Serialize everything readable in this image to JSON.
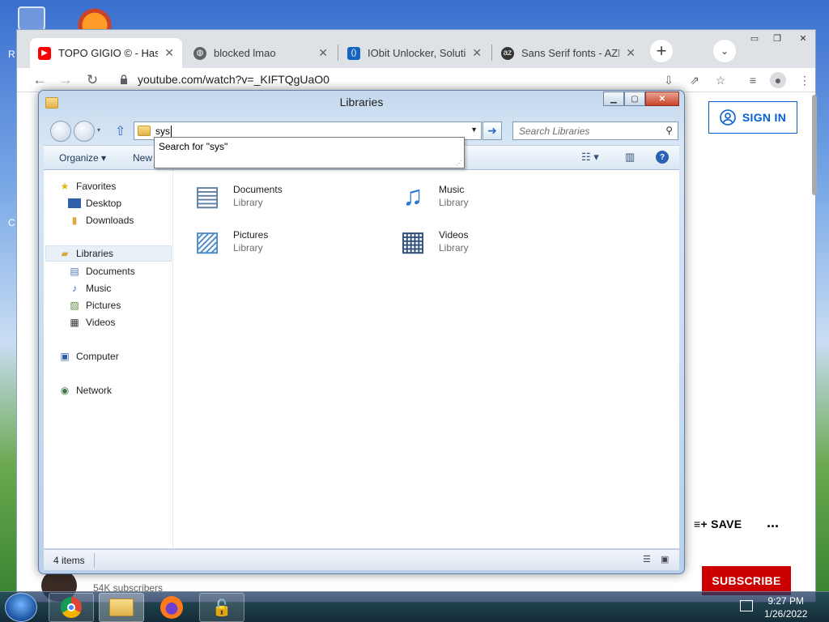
{
  "desktop": {
    "edge_letters": [
      "R",
      "C"
    ]
  },
  "browser": {
    "tabs": [
      {
        "label": "TOPO GIGIO © - Hasta",
        "icon": "youtube-icon",
        "active": true
      },
      {
        "label": "blocked lmao",
        "icon": "globe-icon",
        "active": false
      },
      {
        "label": "IObit Unlocker, Solution",
        "icon": "iobit-icon",
        "active": false
      },
      {
        "label": "Sans Serif fonts - AZFo",
        "icon": "azfonts-icon",
        "active": false
      }
    ],
    "address": "youtube.com/watch?v=_KIFTQgUaO0"
  },
  "youtube": {
    "sign_in": "SIGN IN",
    "save": "SAVE",
    "more": "...",
    "subscribe": "SUBSCRIBE",
    "subscribers": "54K subscribers"
  },
  "explorer": {
    "title": "Libraries",
    "address_value": "sys",
    "search_placeholder": "Search Libraries",
    "suggestion": "Search for \"sys\"",
    "commands": {
      "organize": "Organize",
      "new": "New"
    },
    "nav": {
      "favorites": "Favorites",
      "desktop": "Desktop",
      "downloads": "Downloads",
      "libraries": "Libraries",
      "documents": "Documents",
      "music": "Music",
      "pictures": "Pictures",
      "videos": "Videos",
      "computer": "Computer",
      "network": "Network"
    },
    "libraries": [
      {
        "name": "Documents",
        "type": "Library"
      },
      {
        "name": "Music",
        "type": "Library"
      },
      {
        "name": "Pictures",
        "type": "Library"
      },
      {
        "name": "Videos",
        "type": "Library"
      }
    ],
    "status": "4 items"
  },
  "taskbar": {
    "time": "9:27 PM",
    "date": "1/26/2022"
  }
}
